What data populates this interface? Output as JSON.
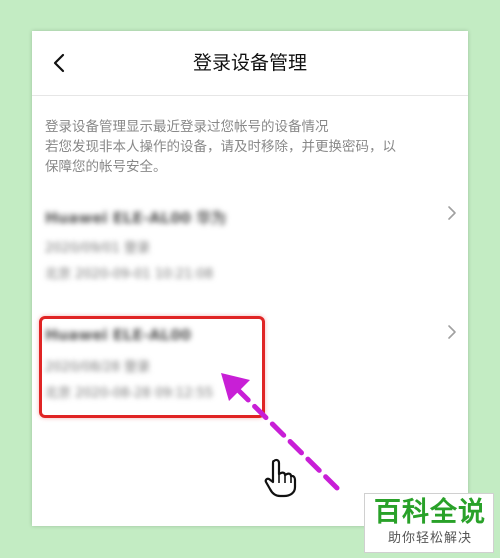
{
  "header": {
    "title": "登录设备管理",
    "back_icon": "chevron-left-icon"
  },
  "info": {
    "line1": "登录设备管理显示最近登录过您帐号的设备情况",
    "line2": "若您发现非本人操作的设备，请及时移除，并更换密码，以",
    "line3": "保障您的帐号安全。"
  },
  "devices": [
    {
      "name": "Huawei ELE-AL00 华为",
      "line2": "2020/09/01 登录",
      "line3": "北京 2020-09-01 10:21:08",
      "icon": "chevron-right-icon"
    },
    {
      "name": "Huawei ELE-AL00",
      "line2": "2020/08/28 登录",
      "line3": "北京 2020-08-28 09:12:55",
      "icon": "chevron-right-icon"
    }
  ],
  "annotation": {
    "highlight_color": "#e02424",
    "arrow_color": "#c81fd6",
    "cursor_icon": "hand-pointer-icon"
  },
  "watermark": {
    "title": "百科全说",
    "subtitle": "助你轻松解决",
    "color": "#29a129"
  },
  "colors": {
    "background": "#c3ecc3",
    "panel": "#ffffff",
    "info_text": "#888888"
  }
}
